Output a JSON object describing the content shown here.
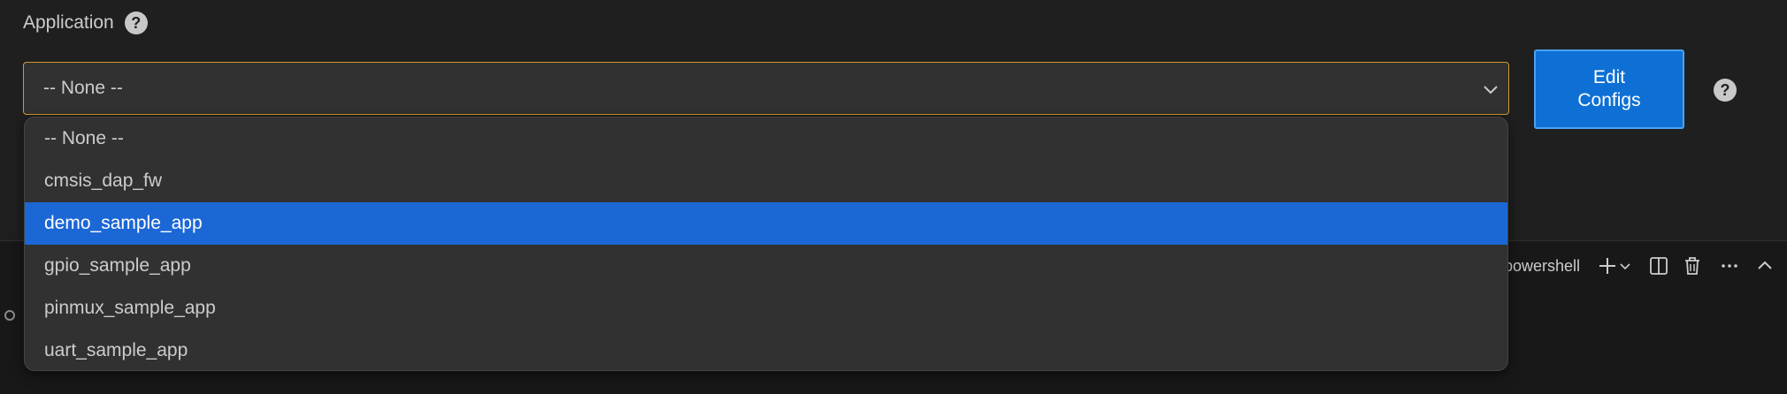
{
  "application": {
    "label": "Application",
    "help_glyph": "?",
    "selected_value": "-- None --",
    "options": [
      {
        "label": "-- None --"
      },
      {
        "label": "cmsis_dap_fw"
      },
      {
        "label": "demo_sample_app",
        "highlighted": true
      },
      {
        "label": "gpio_sample_app"
      },
      {
        "label": "pinmux_sample_app"
      },
      {
        "label": "uart_sample_app"
      }
    ]
  },
  "edit_configs": {
    "label": "Edit\nConfigs"
  },
  "side_help": {
    "glyph": "?"
  },
  "terminal_toolbar": {
    "shell_label": "powershell",
    "icons": [
      "plus-icon",
      "chevron-down-icon",
      "split-icon",
      "trash-icon",
      "more-icon",
      "chevron-up-icon"
    ]
  },
  "colors": {
    "background": "#1f1f1f",
    "select_border_focus": "#d19a2a",
    "primary_button": "#0e70d4",
    "highlight": "#1b67d6"
  }
}
